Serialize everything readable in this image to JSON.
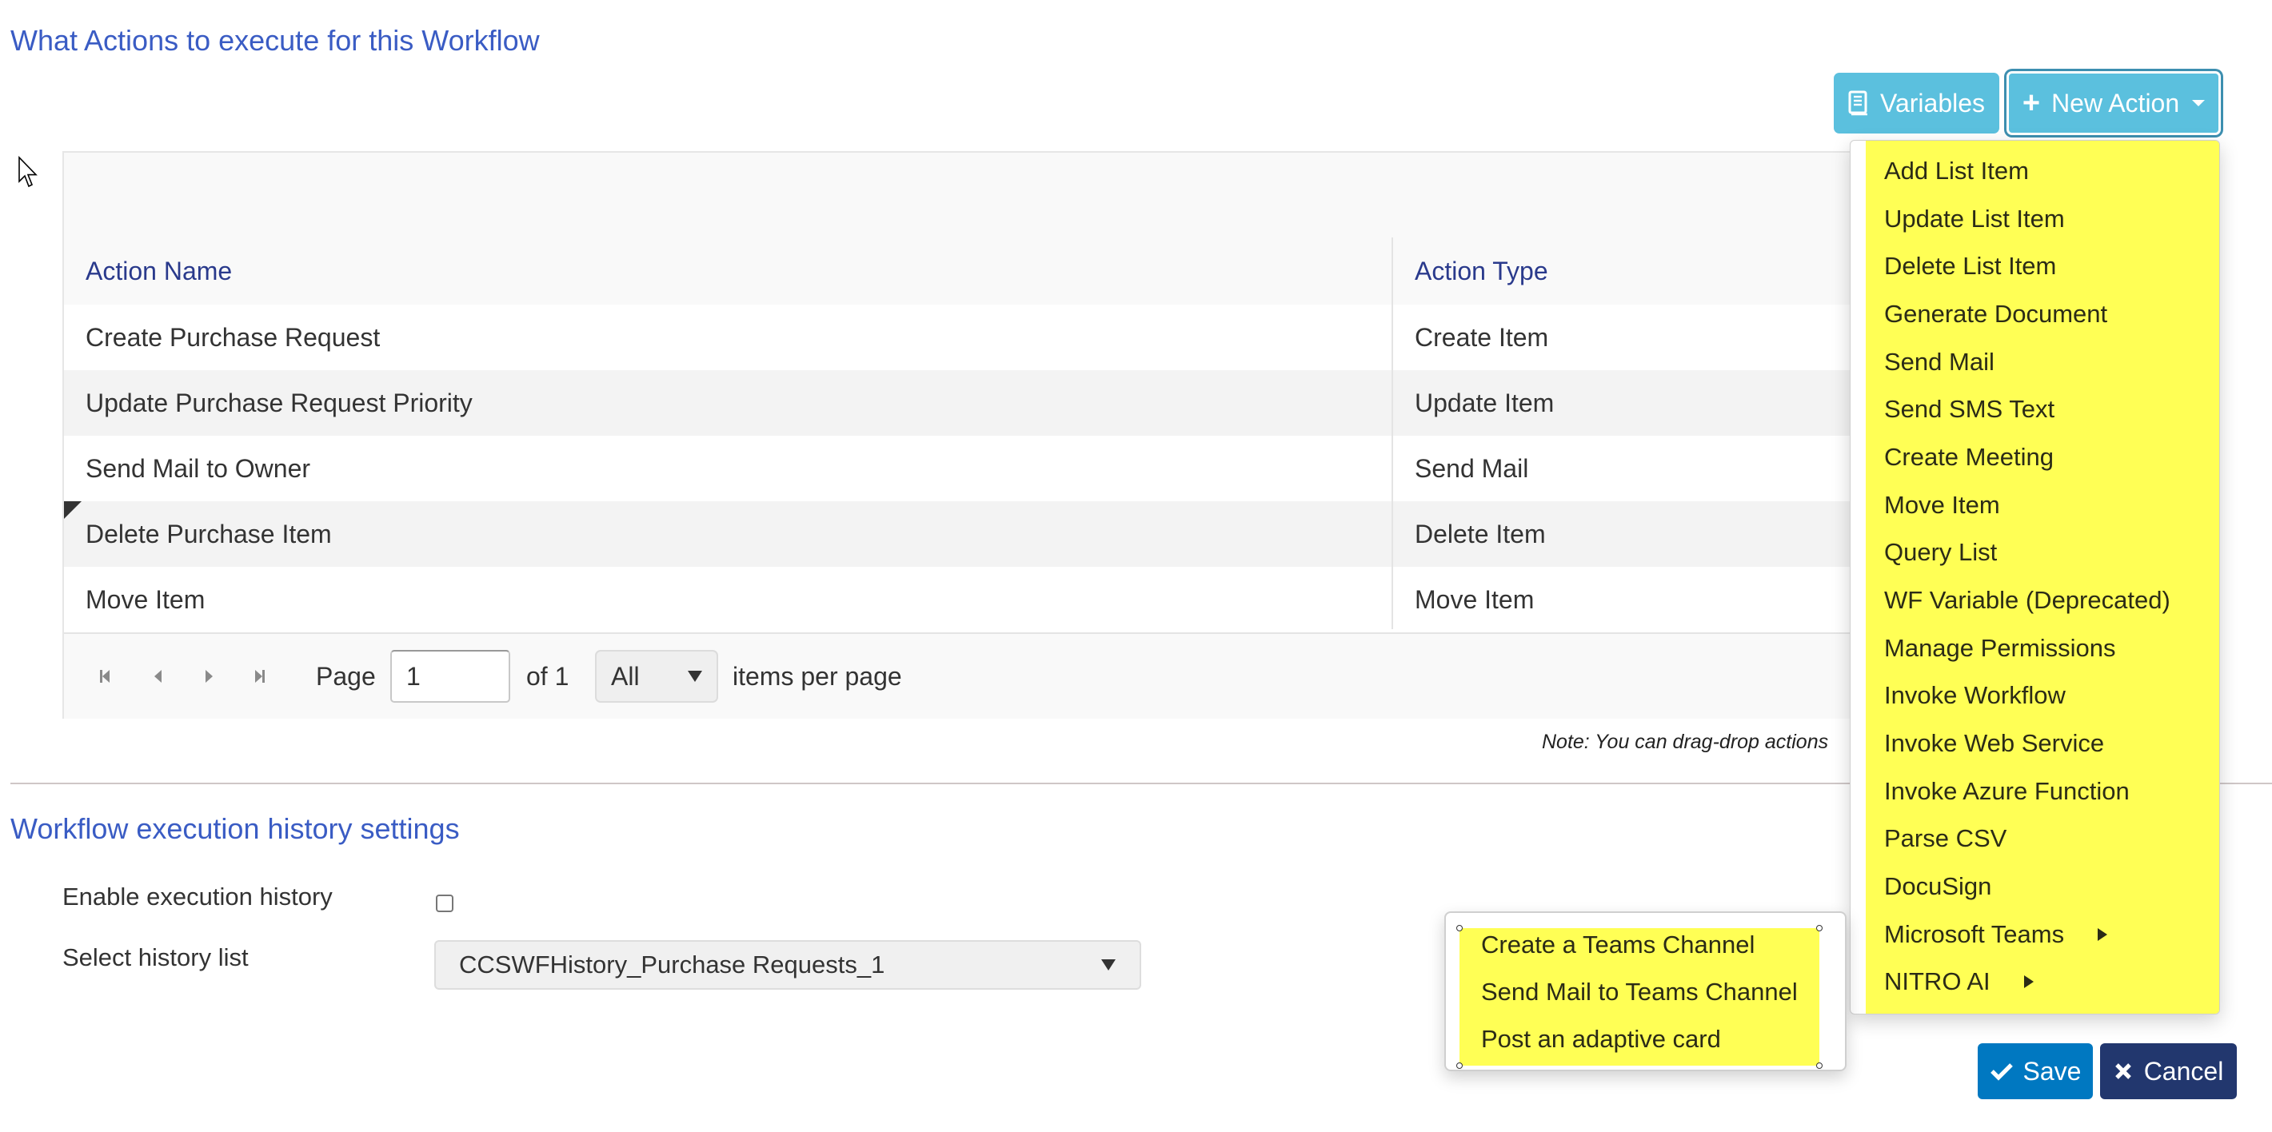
{
  "actions_section": {
    "title": "What Actions to execute for this Workflow",
    "variables_button": "Variables",
    "new_action_button": "New Action",
    "grid": {
      "columns": [
        "Action Name",
        "Action Type"
      ],
      "rows": [
        {
          "name": "Create Purchase Request",
          "type": "Create Item"
        },
        {
          "name": "Update Purchase Request Priority",
          "type": "Update Item"
        },
        {
          "name": "Send Mail to Owner",
          "type": "Send Mail"
        },
        {
          "name": "Delete Purchase Item",
          "type": "Delete Item"
        },
        {
          "name": "Move Item",
          "type": "Move Item"
        }
      ],
      "pager": {
        "page_label": "Page",
        "page_value": "1",
        "of_label": "of 1",
        "per_page_value": "All",
        "per_page_label": "items per page"
      }
    },
    "note": "Note: You can drag-drop actions"
  },
  "new_action_menu": {
    "items": [
      {
        "label": "Add List Item"
      },
      {
        "label": "Update List Item"
      },
      {
        "label": "Delete List Item"
      },
      {
        "label": "Generate Document"
      },
      {
        "label": "Send Mail"
      },
      {
        "label": "Send SMS Text"
      },
      {
        "label": "Create Meeting"
      },
      {
        "label": "Move Item"
      },
      {
        "label": "Query List"
      },
      {
        "label": "WF Variable (Deprecated)"
      },
      {
        "label": "Manage Permissions"
      },
      {
        "label": "Invoke Workflow"
      },
      {
        "label": "Invoke Web Service"
      },
      {
        "label": "Invoke Azure Function"
      },
      {
        "label": "Parse CSV"
      },
      {
        "label": "DocuSign"
      },
      {
        "label": "Microsoft Teams",
        "has_submenu": true
      },
      {
        "label": "NITRO AI",
        "has_submenu": true
      }
    ],
    "teams_submenu": [
      "Create a Teams Channel",
      "Send Mail to Teams Channel",
      "Post an adaptive card"
    ]
  },
  "history_section": {
    "title": "Workflow execution history settings",
    "enable_label": "Enable execution history",
    "enable_checked": false,
    "list_label": "Select history list",
    "list_value": "CCSWFHistory_Purchase Requests_1"
  },
  "footer": {
    "save_label": "Save",
    "cancel_label": "Cancel"
  },
  "colors": {
    "section_title": "#3a5cc4",
    "info_button": "#5bc0de",
    "save_button": "#0078c1",
    "cancel_button": "#22376e",
    "menu_highlight": "#ffff55"
  }
}
